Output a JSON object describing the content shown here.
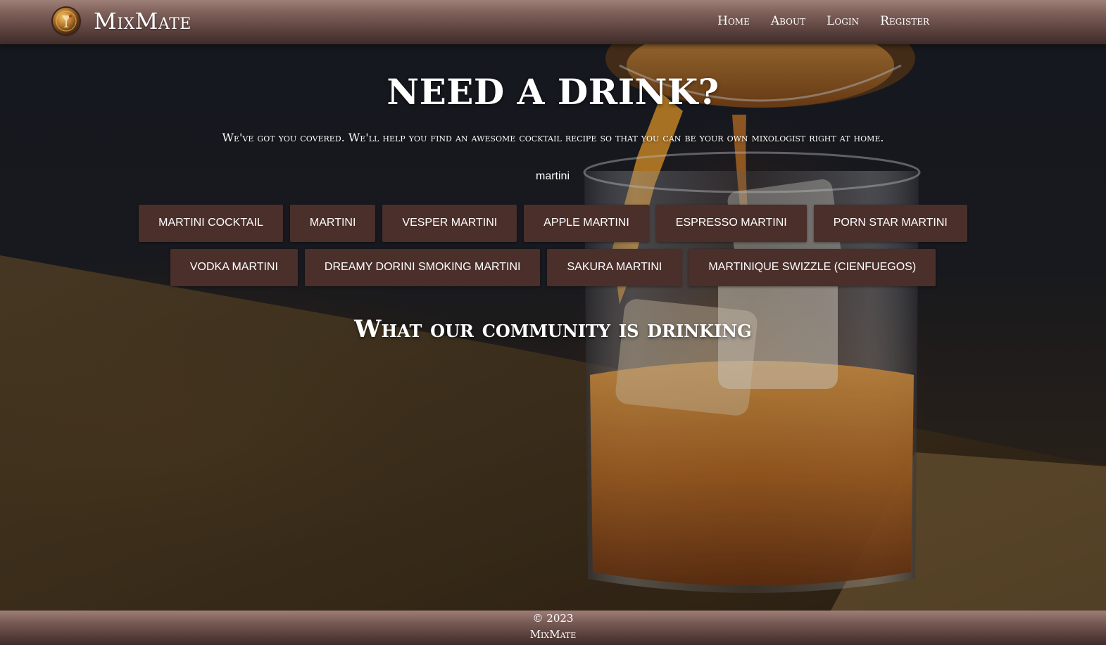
{
  "navbar": {
    "brand": "MixMate",
    "logo_icon": "cocktail-shaker-logo-icon",
    "links": [
      {
        "label": "Home"
      },
      {
        "label": "About"
      },
      {
        "label": "Login"
      },
      {
        "label": "Register"
      }
    ]
  },
  "hero": {
    "headline": "NEED A DRINK?",
    "subline": "We've got you covered. We'll help you find an awesome cocktail recipe so that you can be your own mixologist right at home.",
    "search": {
      "value": "martini"
    },
    "results": [
      {
        "label": "Martini Cocktail"
      },
      {
        "label": "Martini"
      },
      {
        "label": "Vesper Martini"
      },
      {
        "label": "Apple Martini"
      },
      {
        "label": "Espresso Martini"
      },
      {
        "label": "Porn Star Martini"
      },
      {
        "label": "Vodka Martini"
      },
      {
        "label": "Dreamy Dorini Smoking Martini"
      },
      {
        "label": "Sakura Martini"
      },
      {
        "label": "Martinique Swizzle (Cienfuegos)"
      }
    ],
    "community_heading": "What our community is drinking"
  },
  "footer": {
    "copyright": "© 2023",
    "brand": "MixMate"
  },
  "colors": {
    "navbar_top": "#9e7f78",
    "navbar_bottom": "#3e2c29",
    "button_bg": "#4a2f2b",
    "text": "#ffffff"
  }
}
